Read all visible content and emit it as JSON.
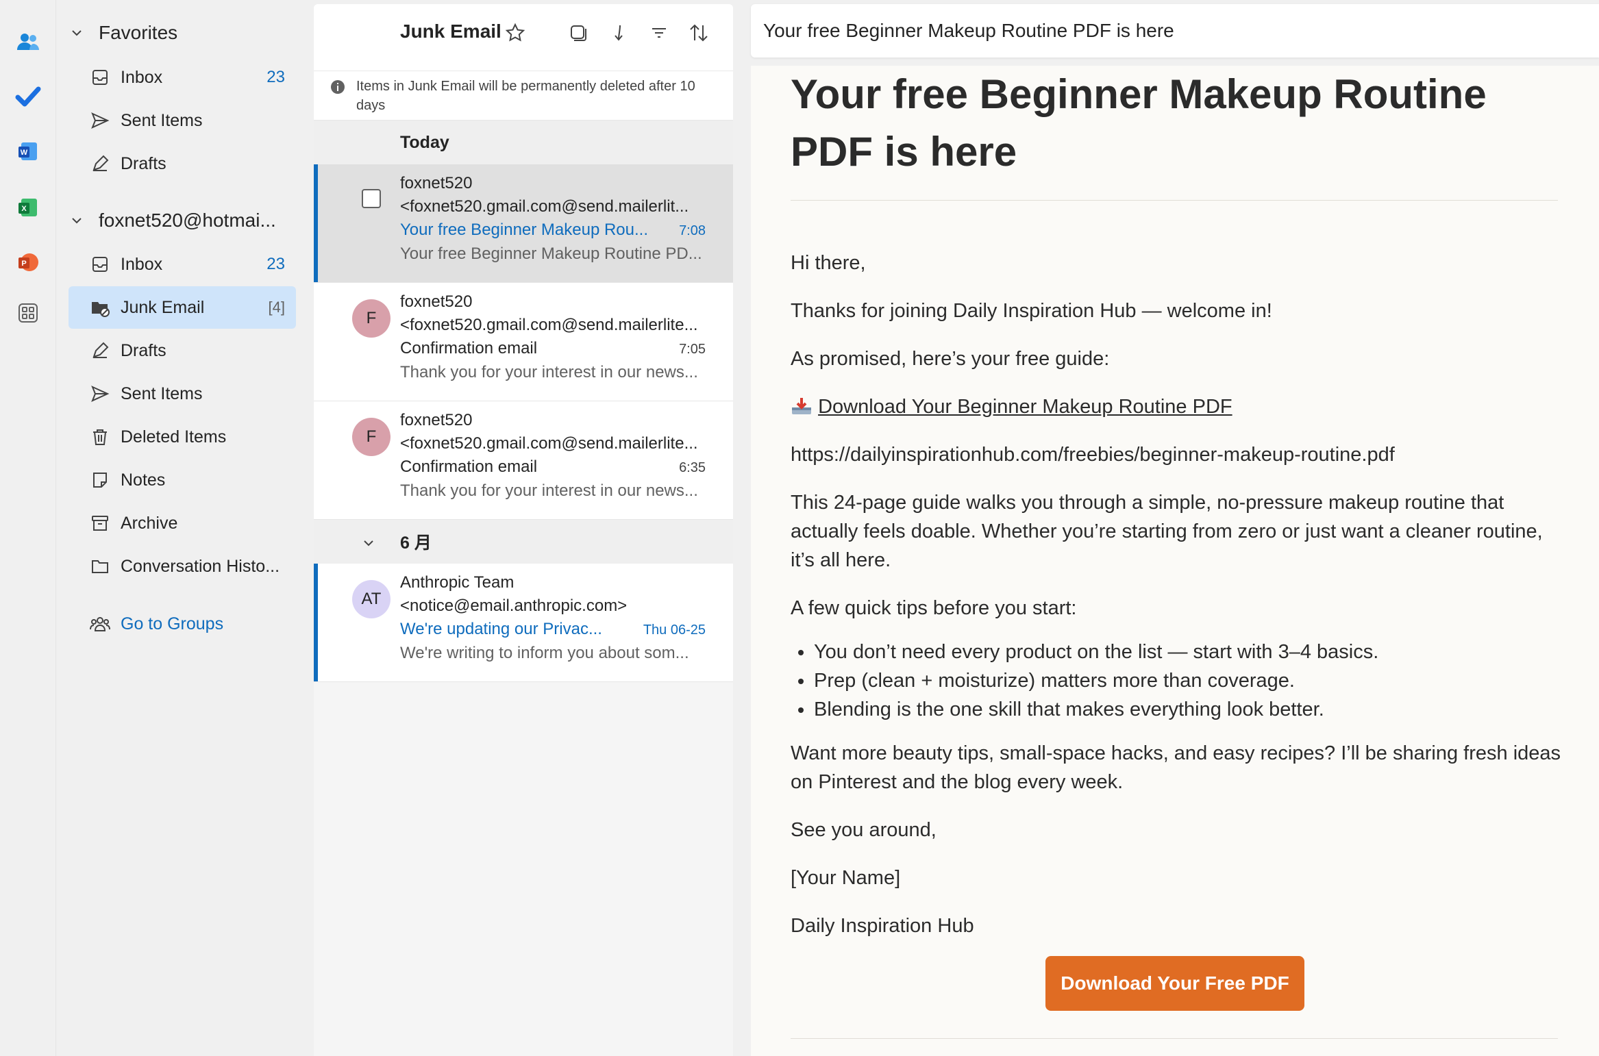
{
  "rail": {
    "items": [
      "people-icon",
      "todo-icon",
      "word-icon",
      "excel-icon",
      "powerpoint-icon",
      "apps-icon"
    ]
  },
  "folders": {
    "favorites_label": "Favorites",
    "favorites": [
      {
        "label": "Inbox",
        "count": "23"
      },
      {
        "label": "Sent Items",
        "count": ""
      },
      {
        "label": "Drafts",
        "count": ""
      }
    ],
    "account_label": "foxnet520@hotmai...",
    "account": [
      {
        "label": "Inbox",
        "count": "23"
      },
      {
        "label": "Junk Email",
        "count": "[4]"
      },
      {
        "label": "Drafts",
        "count": ""
      },
      {
        "label": "Sent Items",
        "count": ""
      },
      {
        "label": "Deleted Items",
        "count": ""
      },
      {
        "label": "Notes",
        "count": ""
      },
      {
        "label": "Archive",
        "count": ""
      },
      {
        "label": "Conversation Histo...",
        "count": ""
      }
    ],
    "groups_link": "Go to Groups"
  },
  "list": {
    "title": "Junk Email",
    "notice": "Items in Junk Email will be permanently deleted after 10 days",
    "section_today": "Today",
    "section_june": "6 月",
    "messages": [
      {
        "avatar": "",
        "sender": "foxnet520",
        "address": "<foxnet520.gmail.com@send.mailerlit...",
        "subject": "Your free Beginner Makeup Rou...",
        "time": "7:08",
        "preview": "Your free Beginner Makeup Routine PD..."
      },
      {
        "avatar": "F",
        "sender": "foxnet520",
        "address": "<foxnet520.gmail.com@send.mailerlite...",
        "subject": "Confirmation email",
        "time": "7:05",
        "preview": "Thank you for your interest in our news..."
      },
      {
        "avatar": "F",
        "sender": "foxnet520",
        "address": "<foxnet520.gmail.com@send.mailerlite...",
        "subject": "Confirmation email",
        "time": "6:35",
        "preview": "Thank you for your interest in our news..."
      },
      {
        "avatar": "AT",
        "sender": "Anthropic Team",
        "address": "<notice@email.anthropic.com>",
        "subject": "We're updating our Privac...",
        "time": "Thu 06-25",
        "preview": "We're writing to inform you about som..."
      }
    ]
  },
  "reader": {
    "subject": "Your free Beginner Makeup Routine PDF is here",
    "heading": "Your free Beginner Makeup Routine PDF is here",
    "greeting": "Hi there,",
    "p1": "Thanks for joining Daily Inspiration Hub — welcome in!",
    "p2": "As promised, here’s your free guide:",
    "download_link": "Download Your Beginner Makeup Routine PDF",
    "url": "https://dailyinspirationhub.com/freebies/beginner-makeup-routine.pdf",
    "p3": "This 24-page guide walks you through a simple, no-pressure makeup routine that actually feels doable. Whether you’re starting from zero or just want a cleaner routine, it’s all here.",
    "tips_intro": "A few quick tips before you start:",
    "tips": [
      "You don’t need every product on the list — start with 3–4 basics.",
      "Prep (clean + moisturize) matters more than coverage.",
      "Blending is the one skill that makes everything look better."
    ],
    "p4": "Want more beauty tips, small-space hacks, and easy recipes? I’ll be sharing fresh ideas on Pinterest and the blog every week.",
    "signoff": "See you around,",
    "name": "[Your Name]",
    "org": "Daily Inspiration Hub",
    "cta": "Download Your Free PDF"
  },
  "colors": {
    "accent": "#0f6cbd",
    "selected_folder": "#cfe4fa",
    "cta": "#e06c23",
    "avatar_f": "#d8a0aa",
    "avatar_at": "#d9d3f5"
  }
}
